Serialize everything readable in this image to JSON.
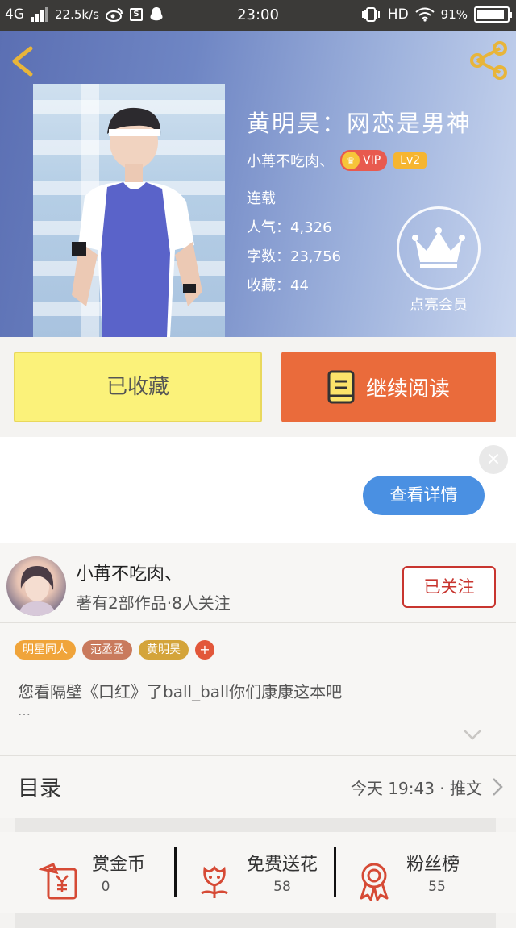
{
  "status_bar": {
    "network": "4G",
    "speed": "22.5k/s",
    "time": "23:00",
    "hd": "HD",
    "battery_pct": "91%",
    "battery_level": 0.91,
    "icons": [
      "signal-icon",
      "weibo-icon",
      "s-app-icon",
      "qq-icon",
      "vibrate-icon",
      "wifi-icon",
      "battery-icon"
    ]
  },
  "header": {
    "back_icon": "chevron-left-icon",
    "share_icon": "share-icon"
  },
  "book": {
    "title": "黄明昊：网恋是男神",
    "author": "小苒不吃肉、",
    "vip_label": "VIP",
    "level_label": "Lv2",
    "status": "连载",
    "popularity_label": "人气：",
    "popularity": "4,326",
    "word_count_label": "字数：",
    "word_count": "23,756",
    "favorites_label": "收藏：",
    "favorites": "44",
    "member_label": "点亮会员"
  },
  "actions": {
    "collected_label": "已收藏",
    "continue_label": "继续阅读"
  },
  "ad": {
    "close_label": "×",
    "detail_label": "查看详情"
  },
  "author_card": {
    "name": "小苒不吃肉、",
    "stats": "著有2部作品·8人关注",
    "follow_label": "已关注",
    "tags": [
      {
        "label": "明星同人",
        "color": "#f0a43a"
      },
      {
        "label": "范丞丞",
        "color": "#c97a5d"
      },
      {
        "label": "黄明昊",
        "color": "#d4a43a"
      }
    ],
    "tag_add": "+",
    "intro": "您看隔壁《口红》了ball_ball你们康康这本吧",
    "intro_ellipsis": "…"
  },
  "toc": {
    "title": "目录",
    "latest": "今天 19:43 · 推文"
  },
  "bottom_stats": [
    {
      "label": "赏金币",
      "value": "0",
      "icon": "red-envelope-icon"
    },
    {
      "label": "免费送花",
      "value": "58",
      "icon": "flower-icon"
    },
    {
      "label": "粉丝榜",
      "value": "55",
      "icon": "ribbon-medal-icon"
    }
  ],
  "colors": {
    "accent_orange": "#ea6b3b",
    "collected_yellow": "#fbf27a",
    "follow_red": "#c8352f",
    "detail_blue": "#4a90e2",
    "icon_red": "#d64a35"
  }
}
